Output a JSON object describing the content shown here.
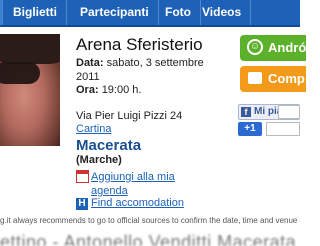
{
  "nav": {
    "tabs": [
      "Biglietti",
      "Partecipanti",
      "Foto",
      "Videos"
    ]
  },
  "event": {
    "venue": "Arena Sferisterio",
    "date_label": "Data:",
    "date_value": "sabato, 3 settembre 2011",
    "time_label": "Ora:",
    "time_value": "19:00 h.",
    "address": "Via Pier Luigi Pizzi 24",
    "map_link": "Cartina",
    "city": "Macerata",
    "region": "(Marche)",
    "agenda_link": "Aggiungi alla mia agenda",
    "accommodation_link": "Find accomodation"
  },
  "actions": {
    "green_button": "Andró",
    "orange_button": "Comp"
  },
  "social": {
    "fb_like": "Mi piace",
    "gplus": "+1"
  },
  "footer": {
    "disclaimer": "g.it always recommends to go to official sources to confirm the date, time and venue of",
    "bottom_heading": "ettino - Antonello Venditti Macerata"
  },
  "colors": {
    "nav": "#1d62b6",
    "green": "#5bb22a",
    "orange": "#f39a1b",
    "city": "#1b4f8f"
  }
}
